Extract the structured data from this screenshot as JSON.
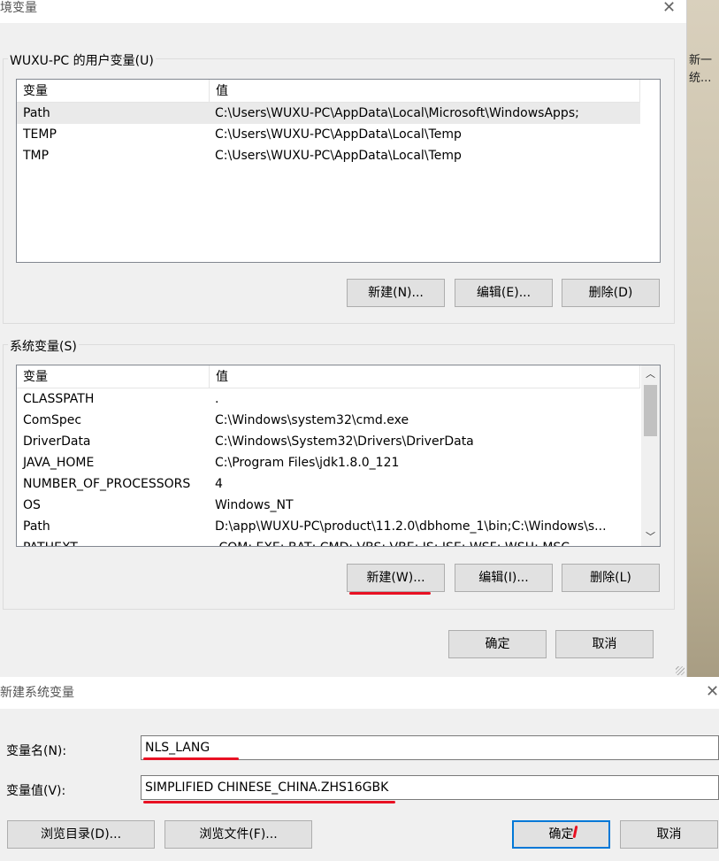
{
  "desktop": {
    "line1": "新一",
    "line2": "统..."
  },
  "env_dialog": {
    "title": "环境变量",
    "user_group": {
      "label": "WUXU-PC 的用户变量(U)",
      "col_var": "变量",
      "col_val": "值",
      "rows": [
        {
          "name": "Path",
          "value": "C:\\Users\\WUXU-PC\\AppData\\Local\\Microsoft\\WindowsApps;"
        },
        {
          "name": "TEMP",
          "value": "C:\\Users\\WUXU-PC\\AppData\\Local\\Temp"
        },
        {
          "name": "TMP",
          "value": "C:\\Users\\WUXU-PC\\AppData\\Local\\Temp"
        }
      ],
      "btn_new": "新建(N)...",
      "btn_edit": "编辑(E)...",
      "btn_delete": "删除(D)"
    },
    "system_group": {
      "label": "系统变量(S)",
      "col_var": "变量",
      "col_val": "值",
      "rows": [
        {
          "name": "CLASSPATH",
          "value": "."
        },
        {
          "name": "ComSpec",
          "value": "C:\\Windows\\system32\\cmd.exe"
        },
        {
          "name": "DriverData",
          "value": "C:\\Windows\\System32\\Drivers\\DriverData"
        },
        {
          "name": "JAVA_HOME",
          "value": "C:\\Program Files\\jdk1.8.0_121"
        },
        {
          "name": "NUMBER_OF_PROCESSORS",
          "value": "4"
        },
        {
          "name": "OS",
          "value": "Windows_NT"
        },
        {
          "name": "Path",
          "value": "D:\\app\\WUXU-PC\\product\\11.2.0\\dbhome_1\\bin;C:\\Windows\\s..."
        },
        {
          "name": "PATHEXT",
          "value": ".COM;.EXE;.BAT;.CMD;.VBS;.VBE;.JS;.JSE;.WSF;.WSH;.MSC"
        }
      ],
      "btn_new": "新建(W)...",
      "btn_edit": "编辑(I)...",
      "btn_delete": "删除(L)"
    },
    "btn_ok": "确定",
    "btn_cancel": "取消"
  },
  "new_dialog": {
    "title": "新建系统变量",
    "name_label": "变量名(N):",
    "name_value": "NLS_LANG",
    "value_label": "变量值(V):",
    "value_value": "SIMPLIFIED CHINESE_CHINA.ZHS16GBK",
    "btn_browse_dir": "浏览目录(D)...",
    "btn_browse_file": "浏览文件(F)...",
    "btn_ok": "确定",
    "btn_cancel": "取消"
  },
  "colors": {
    "highlight_red": "#e81123",
    "selected_row": "#eaeaea",
    "dialog_bg": "#f0f0f0"
  }
}
